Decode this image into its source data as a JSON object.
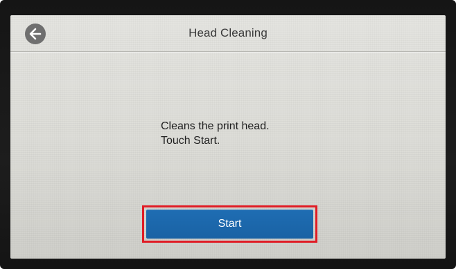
{
  "header": {
    "title": "Head Cleaning"
  },
  "message": {
    "line1": "Cleans the print head.",
    "line2": "Touch Start."
  },
  "actions": {
    "start_label": "Start"
  },
  "colors": {
    "start_button": "#1a64a8",
    "highlight": "#e01b24",
    "back_button": "#6f6f6f"
  },
  "icons": {
    "back": "arrow-left-icon"
  }
}
